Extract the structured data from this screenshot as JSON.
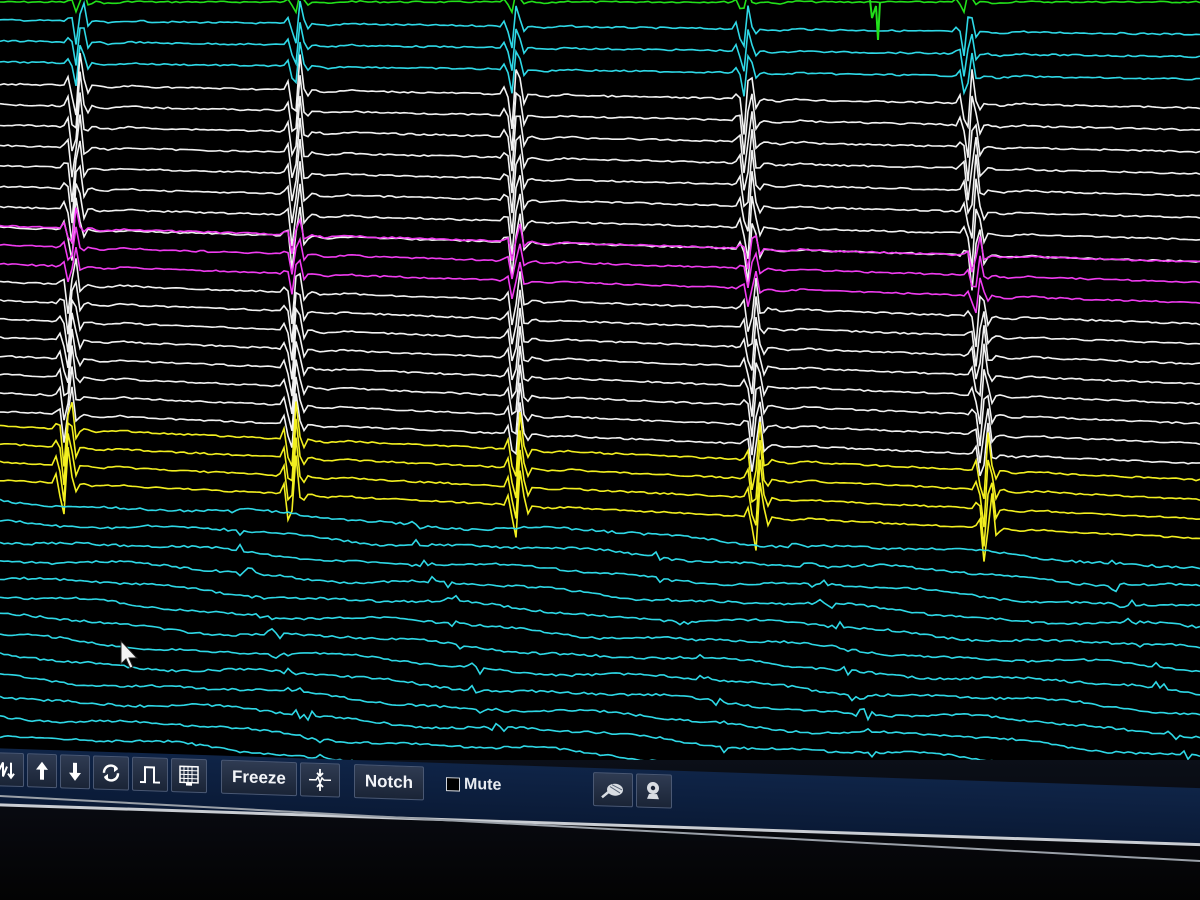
{
  "app": {
    "colors": {
      "background": "#000000",
      "trace_green": "#22e01a",
      "trace_cyan": "#2ed8e6",
      "trace_white": "#f2f2f2",
      "trace_magenta": "#f03cf0",
      "trace_yellow": "#f2ef20",
      "toolbar_bg": "#0f2447"
    }
  },
  "toolbar": {
    "buttons": [
      {
        "icon": "waveform-arrows-icon"
      },
      {
        "icon": "arrow-up-icon"
      },
      {
        "icon": "arrow-down-icon"
      },
      {
        "icon": "refresh-icon"
      },
      {
        "icon": "pulse-icon"
      },
      {
        "icon": "grid-icon"
      }
    ],
    "freeze_label": "Freeze",
    "scale_icon": "compress-traces-icon",
    "notch_label": "Notch",
    "mute_label": "Mute",
    "mute_checked": false,
    "right_icons": [
      "catheter-icon",
      "settings-icon"
    ]
  }
}
